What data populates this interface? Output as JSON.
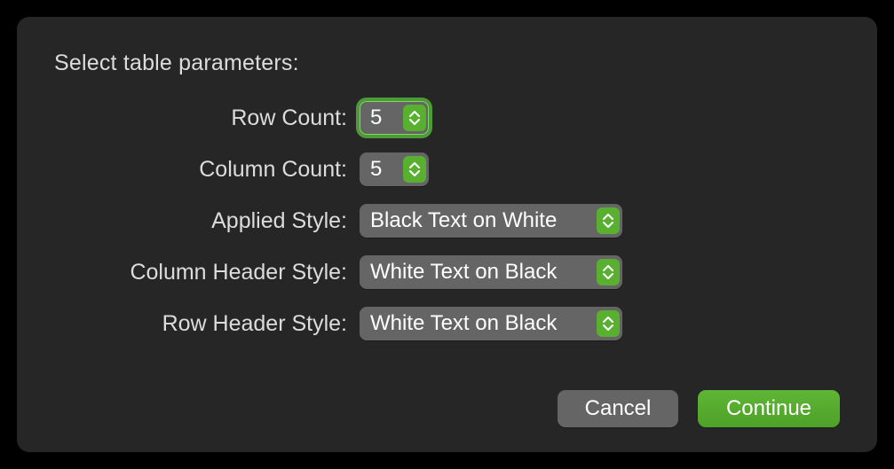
{
  "prompt": "Select table parameters:",
  "fields": {
    "rowCount": {
      "label": "Row Count:",
      "value": "5"
    },
    "colCount": {
      "label": "Column Count:",
      "value": "5"
    },
    "applied": {
      "label": "Applied Style:",
      "value": "Black Text on White"
    },
    "colHeader": {
      "label": "Column Header Style:",
      "value": "White Text on Black"
    },
    "rowHeader": {
      "label": "Row Header Style:",
      "value": "White Text on Black"
    }
  },
  "buttons": {
    "cancel": "Cancel",
    "continue": "Continue"
  },
  "colors": {
    "accent": "#59b030"
  }
}
